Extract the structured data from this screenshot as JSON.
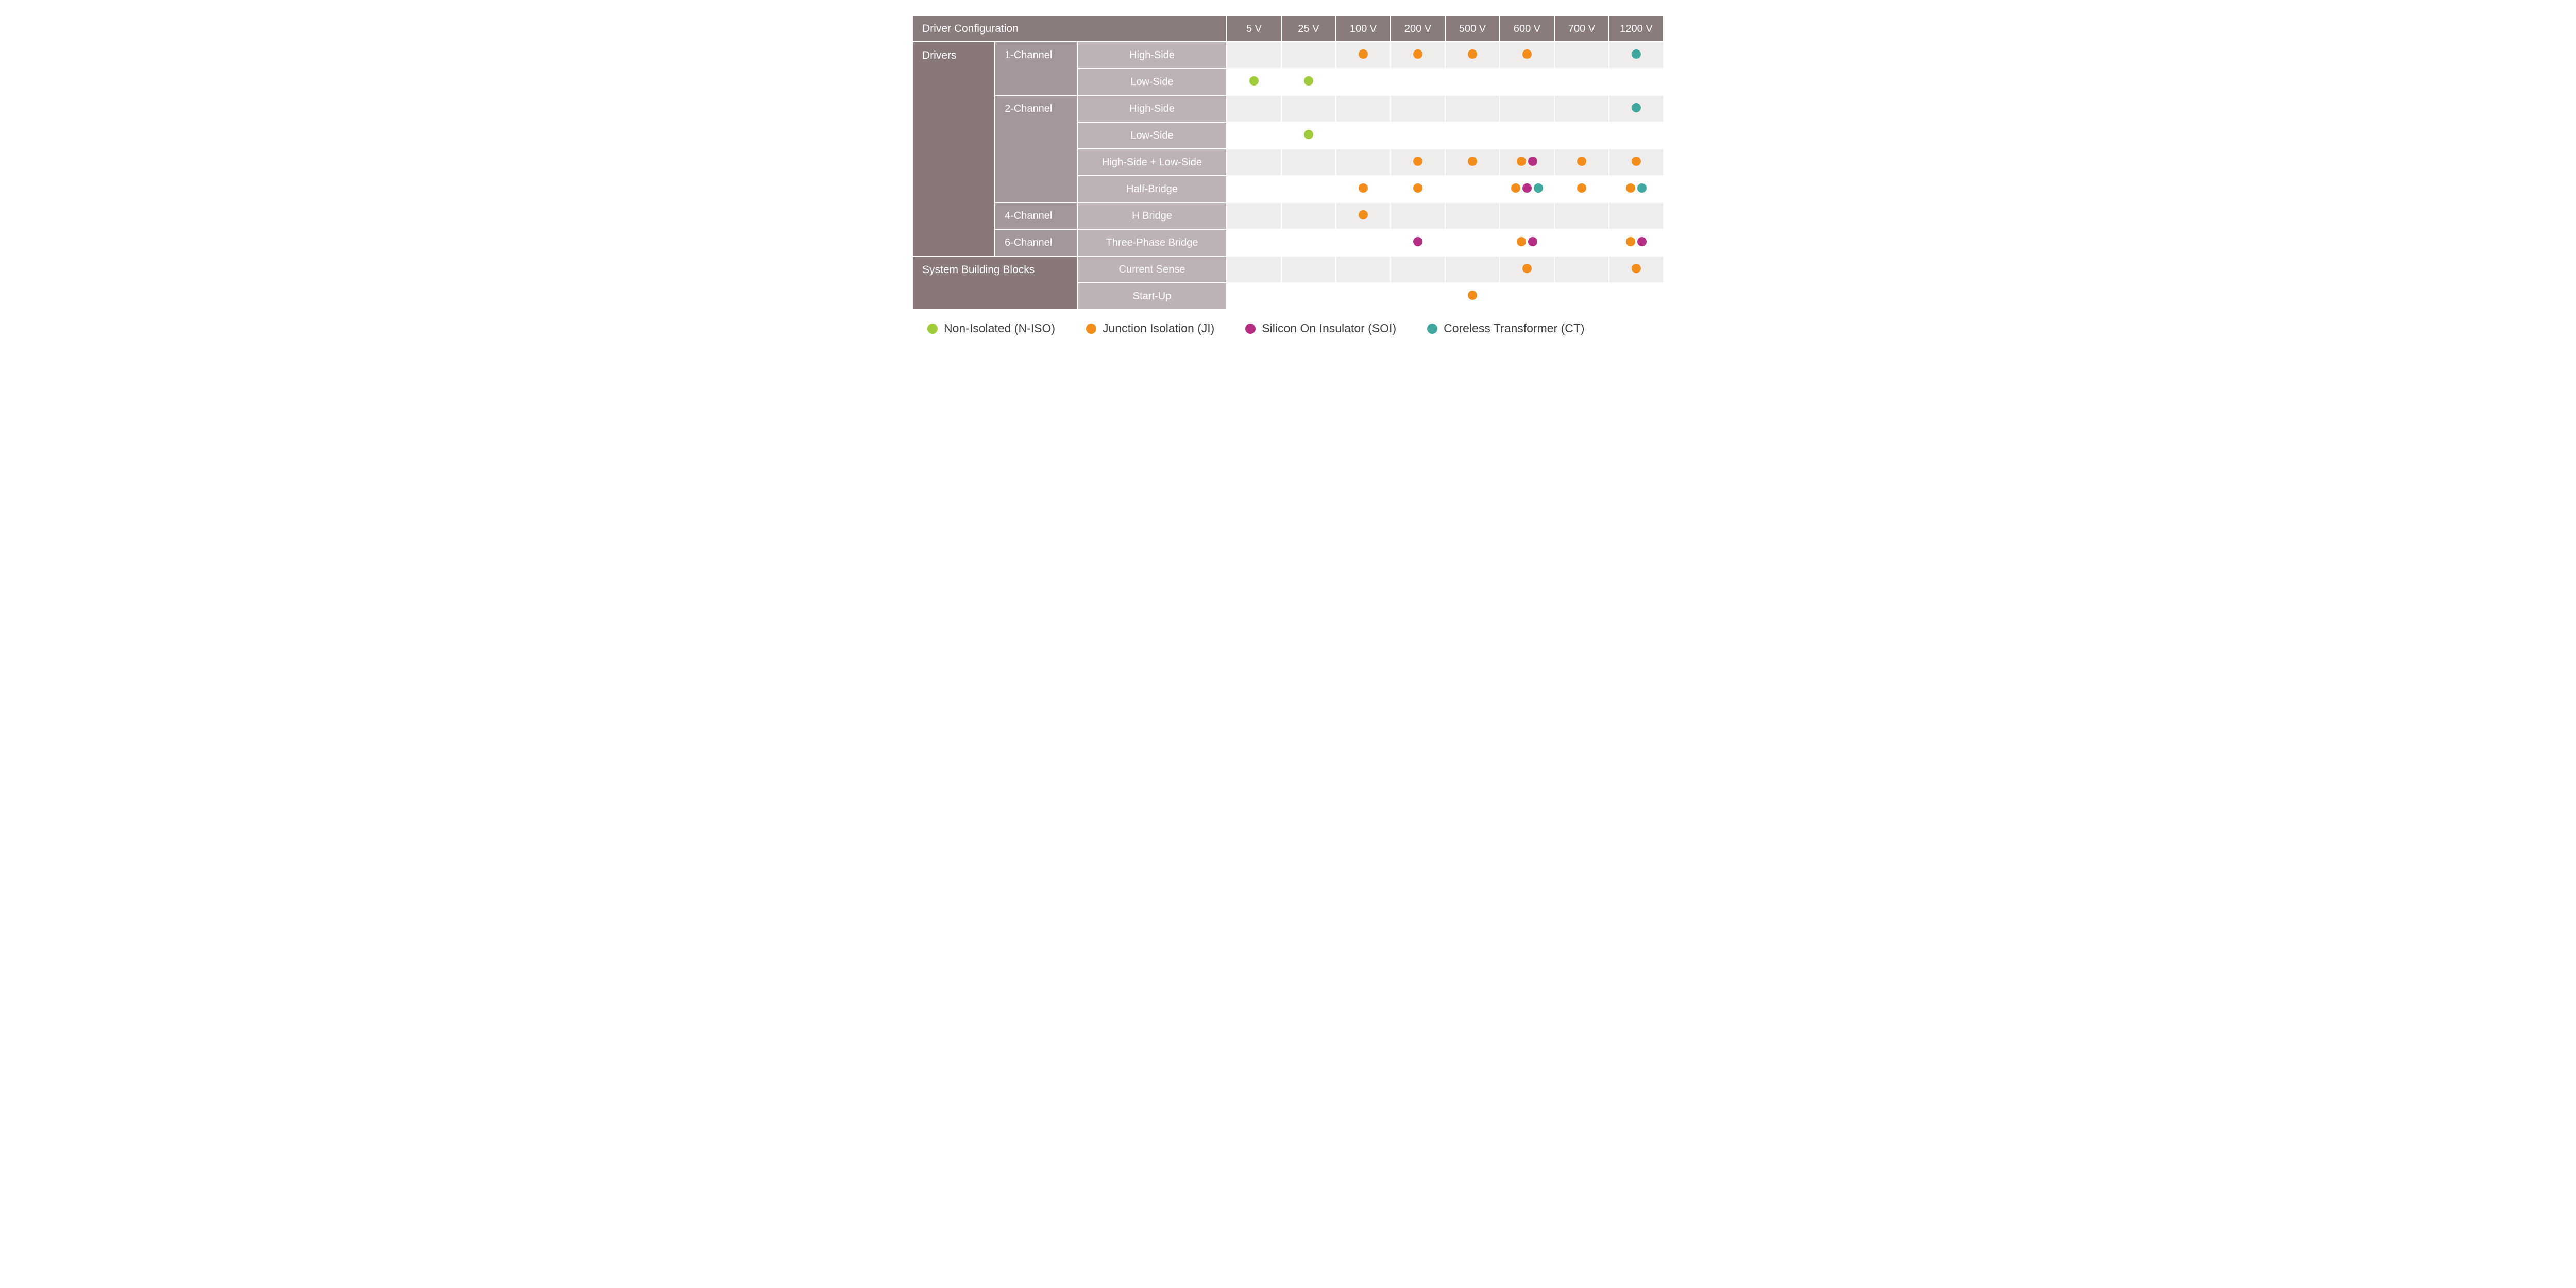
{
  "header": {
    "config_label": "Driver Configuration",
    "voltages": [
      "5 V",
      "25 V",
      "100 V",
      "200 V",
      "500 V",
      "600 V",
      "700 V",
      "1200 V"
    ]
  },
  "groups": [
    {
      "label": "Drivers",
      "channels": [
        {
          "label": "1-Channel",
          "rows": [
            {
              "label": "High-Side",
              "shade": true,
              "cells": [
                [],
                [],
                [
                  "ji"
                ],
                [
                  "ji"
                ],
                [
                  "ji"
                ],
                [
                  "ji"
                ],
                [],
                [
                  "ct"
                ]
              ]
            },
            {
              "label": "Low-Side",
              "shade": false,
              "cells": [
                [
                  "niso"
                ],
                [
                  "niso"
                ],
                [],
                [],
                [],
                [],
                [],
                []
              ]
            }
          ]
        },
        {
          "label": "2-Channel",
          "rows": [
            {
              "label": "High-Side",
              "shade": true,
              "cells": [
                [],
                [],
                [],
                [],
                [],
                [],
                [],
                [
                  "ct"
                ]
              ]
            },
            {
              "label": "Low-Side",
              "shade": false,
              "cells": [
                [],
                [
                  "niso"
                ],
                [],
                [],
                [],
                [],
                [],
                []
              ]
            },
            {
              "label": "High-Side + Low-Side",
              "shade": true,
              "cells": [
                [],
                [],
                [],
                [
                  "ji"
                ],
                [
                  "ji"
                ],
                [
                  "ji",
                  "soi"
                ],
                [
                  "ji"
                ],
                [
                  "ji"
                ]
              ]
            },
            {
              "label": "Half-Bridge",
              "shade": false,
              "cells": [
                [],
                [],
                [
                  "ji"
                ],
                [
                  "ji"
                ],
                [],
                [
                  "ji",
                  "soi",
                  "ct"
                ],
                [
                  "ji"
                ],
                [
                  "ji",
                  "ct"
                ]
              ]
            }
          ]
        },
        {
          "label": "4-Channel",
          "rows": [
            {
              "label": "H Bridge",
              "shade": true,
              "cells": [
                [],
                [],
                [
                  "ji"
                ],
                [],
                [],
                [],
                [],
                []
              ]
            }
          ]
        },
        {
          "label": "6-Channel",
          "rows": [
            {
              "label": "Three-Phase Bridge",
              "shade": false,
              "cells": [
                [],
                [],
                [],
                [
                  "soi"
                ],
                [],
                [
                  "ji",
                  "soi"
                ],
                [],
                [
                  "ji",
                  "soi"
                ]
              ]
            }
          ]
        }
      ]
    },
    {
      "label": "System Building Blocks",
      "channels": [
        {
          "label": "",
          "rows": [
            {
              "label": "Current Sense",
              "shade": true,
              "cells": [
                [],
                [],
                [],
                [],
                [],
                [
                  "ji"
                ],
                [],
                [
                  "ji"
                ]
              ]
            },
            {
              "label": "Start-Up",
              "shade": false,
              "cells": [
                [],
                [],
                [],
                [],
                [
                  "ji"
                ],
                [],
                [],
                []
              ]
            }
          ]
        }
      ]
    }
  ],
  "legend": [
    {
      "key": "niso",
      "label": "Non-Isolated (N-ISO)"
    },
    {
      "key": "ji",
      "label": "Junction Isolation (JI)"
    },
    {
      "key": "soi",
      "label": "Silicon On Insulator (SOI)"
    },
    {
      "key": "ct",
      "label": "Coreless Transformer (CT)"
    }
  ],
  "colors": {
    "niso": "#a0cb3a",
    "ji": "#f28c1b",
    "soi": "#b42e83",
    "ct": "#3fa79e"
  }
}
